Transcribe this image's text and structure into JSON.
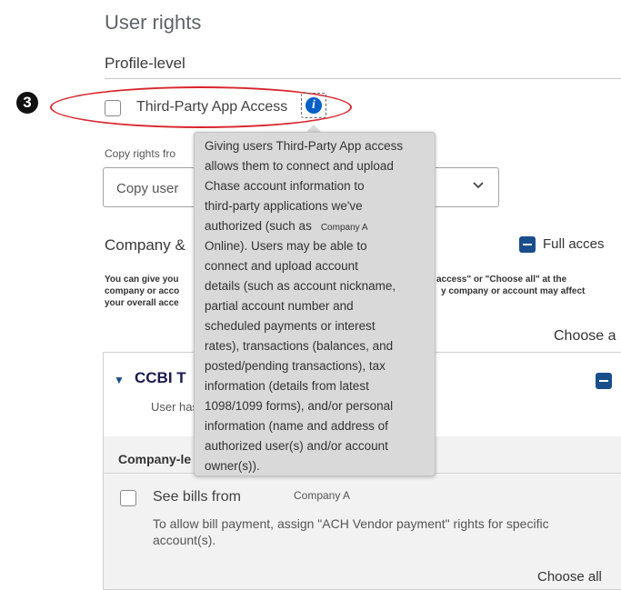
{
  "page": {
    "title": "User rights",
    "section": "Profile-level",
    "step_number": "3"
  },
  "third_party": {
    "label": "Third-Party App Access",
    "info_icon": "info-icon",
    "tooltip_lines": [
      "Giving users Third-Party App access",
      "allows them to connect and upload",
      "Chase account information to",
      "third-party applications we've",
      "authorized (such as",
      "Online). Users may be able to",
      "connect and upload account",
      "details (such as account nickname,",
      "partial account number and",
      "scheduled payments or interest",
      "rates), transactions (balances, and",
      "posted/pending transactions), tax",
      "information (details from latest",
      "1098/1099 forms), and/or personal",
      "information (name and address of",
      "authorized user(s) and/or account",
      "owner(s))."
    ],
    "tooltip_company": "Company A"
  },
  "copy_rights": {
    "label": "Copy rights fro",
    "select_value": "Copy user"
  },
  "company_section": {
    "title": "Company &",
    "full_access_label": "Full acces",
    "desc_left": [
      "You can give you",
      "company or acco",
      "your overall acce"
    ],
    "desc_right": [
      "access\" or \"Choose all\" at the",
      "y company or account may affect"
    ],
    "choose_all_top": "Choose a"
  },
  "company_panel": {
    "name": "CCBI T",
    "user_has": "User has",
    "company_level": "Company-le",
    "see_bills_label": "See bills from",
    "see_bills_company": "Company A",
    "allow_line1": "To allow bill payment, assign \"ACH Vendor payment\" rights for specific",
    "allow_line2": "account(s).",
    "choose_all": "Choose all"
  },
  "colors": {
    "accent": "#1a4e8a",
    "info_blue": "#0060c7",
    "highlight_red": "#d8262e",
    "tooltip_bg": "#d9d9d9"
  }
}
